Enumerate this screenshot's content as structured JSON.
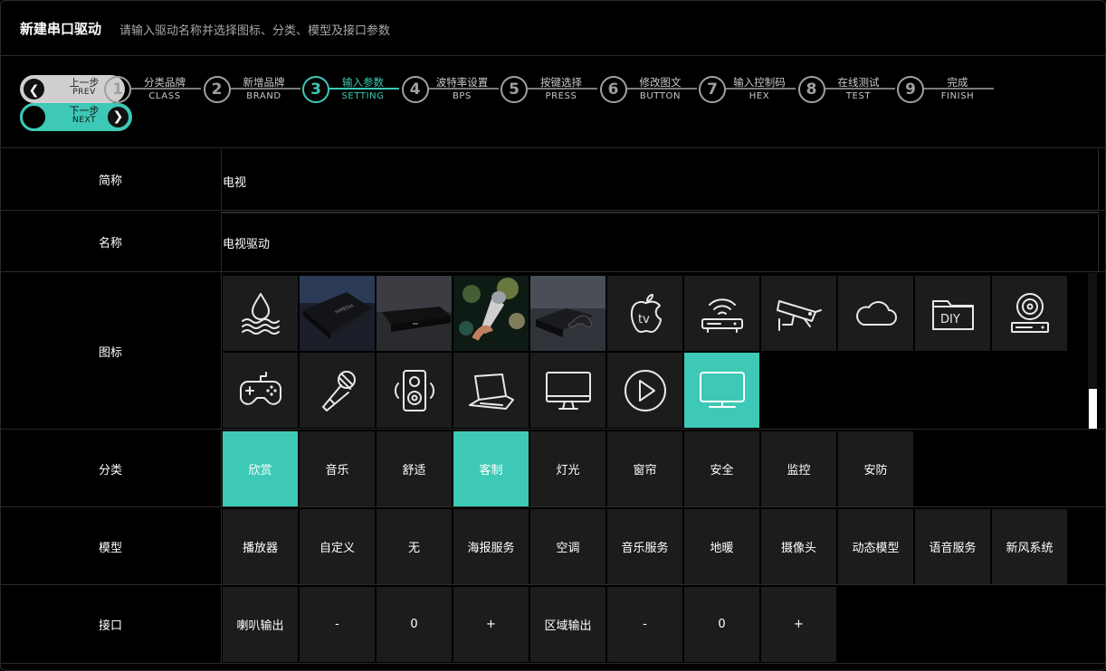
{
  "header": {
    "title": "新建串口驱动",
    "subtitle": "请输入驱动名称并选择图标、分类、模型及接口参数"
  },
  "nav": {
    "prev_cn": "上一步",
    "prev_en": "PREV",
    "next_cn": "下一步",
    "next_en": "NEXT"
  },
  "steps": [
    {
      "num": "1",
      "cn": "分类品牌",
      "en": "CLASS"
    },
    {
      "num": "2",
      "cn": "新增品牌",
      "en": "BRAND"
    },
    {
      "num": "3",
      "cn": "输入参数",
      "en": "SETTING"
    },
    {
      "num": "4",
      "cn": "波特率设置",
      "en": "BPS"
    },
    {
      "num": "5",
      "cn": "按键选择",
      "en": "PRESS"
    },
    {
      "num": "6",
      "cn": "修改图文",
      "en": "BUTTON"
    },
    {
      "num": "7",
      "cn": "输入控制码",
      "en": "HEX"
    },
    {
      "num": "8",
      "cn": "在线测试",
      "en": "TEST"
    },
    {
      "num": "9",
      "cn": "完成",
      "en": "FINISH"
    }
  ],
  "active_step": 3,
  "accent_color": "#3dc9b6",
  "form": {
    "short_name_label": "简称",
    "short_name_value": "电视",
    "name_label": "名称",
    "name_value": "电视驱动",
    "icon_label": "图标",
    "category_label": "分类",
    "model_label": "模型",
    "interface_label": "接口"
  },
  "icons": [
    {
      "name": "water-waves-icon"
    },
    {
      "name": "media-box-photo"
    },
    {
      "name": "set-top-box-photo"
    },
    {
      "name": "microphone-stage-photo"
    },
    {
      "name": "game-console-photo"
    },
    {
      "name": "apple-tv-icon",
      "text": "tv"
    },
    {
      "name": "wifi-router-icon"
    },
    {
      "name": "security-camera-icon"
    },
    {
      "name": "cloud-icon"
    },
    {
      "name": "diy-folder-icon",
      "text": "DIY"
    },
    {
      "name": "disc-player-icon"
    },
    {
      "name": "gamepad-icon"
    },
    {
      "name": "microphone-icon"
    },
    {
      "name": "speaker-icon"
    },
    {
      "name": "laptop-icon"
    },
    {
      "name": "monitor-icon"
    },
    {
      "name": "play-icon"
    },
    {
      "name": "tv-icon",
      "selected": true
    }
  ],
  "categories": [
    {
      "label": "欣赏",
      "selected": true
    },
    {
      "label": "音乐",
      "selected": false
    },
    {
      "label": "舒适",
      "selected": false
    },
    {
      "label": "客制",
      "selected": true
    },
    {
      "label": "灯光",
      "selected": false
    },
    {
      "label": "窗帘",
      "selected": false
    },
    {
      "label": "安全",
      "selected": false
    },
    {
      "label": "监控",
      "selected": false
    },
    {
      "label": "安防",
      "selected": false
    }
  ],
  "models": [
    {
      "label": "播放器"
    },
    {
      "label": "自定义"
    },
    {
      "label": "无"
    },
    {
      "label": "海报服务"
    },
    {
      "label": "空调"
    },
    {
      "label": "音乐服务"
    },
    {
      "label": "地暖"
    },
    {
      "label": "摄像头"
    },
    {
      "label": "动态模型"
    },
    {
      "label": "语音服务"
    },
    {
      "label": "新风系统"
    }
  ],
  "interfaces": [
    {
      "label": "喇叭输出"
    },
    {
      "label": "-"
    },
    {
      "label": "0"
    },
    {
      "label": "+"
    },
    {
      "label": "区域输出"
    },
    {
      "label": "-"
    },
    {
      "label": "0"
    },
    {
      "label": "+"
    }
  ]
}
